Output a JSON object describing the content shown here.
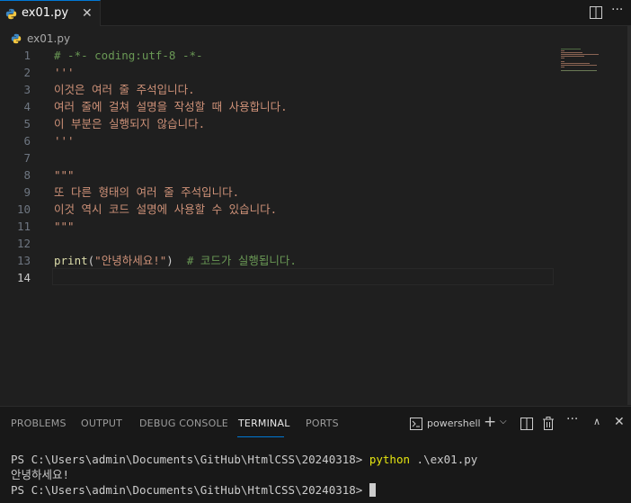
{
  "tab": {
    "title": "ex01.py",
    "close": "✕",
    "icon": "python-icon"
  },
  "tab_actions": {
    "split": "split-editor-icon",
    "more": "ellipsis-icon"
  },
  "breadcrumb": {
    "file": "ex01.py"
  },
  "editor": {
    "line_numbers": [
      "1",
      "2",
      "3",
      "4",
      "5",
      "6",
      "7",
      "8",
      "9",
      "10",
      "11",
      "12",
      "13",
      "14"
    ],
    "active_line": 14,
    "lines": [
      {
        "n": "1",
        "text": "# -*- coding:utf-8 -*-",
        "kind": "comment"
      },
      {
        "n": "2",
        "text": "'''",
        "kind": "string"
      },
      {
        "n": "3",
        "text": "이것은 여러 줄 주석입니다.",
        "kind": "string"
      },
      {
        "n": "4",
        "text": "여러 줄에 걸쳐 설명을 작성할 때 사용합니다.",
        "kind": "string"
      },
      {
        "n": "5",
        "text": "이 부분은 실행되지 않습니다.",
        "kind": "string"
      },
      {
        "n": "6",
        "text": "'''",
        "kind": "string"
      },
      {
        "n": "7",
        "text": "",
        "kind": "plain"
      },
      {
        "n": "8",
        "text": "\"\"\"",
        "kind": "string"
      },
      {
        "n": "9",
        "text": "또 다른 형태의 여러 줄 주석입니다.",
        "kind": "string"
      },
      {
        "n": "10",
        "text": "이것 역시 코드 설명에 사용할 수 있습니다.",
        "kind": "string"
      },
      {
        "n": "11",
        "text": "\"\"\"",
        "kind": "string"
      },
      {
        "n": "12",
        "text": "",
        "kind": "plain"
      }
    ],
    "line13": {
      "func": "print",
      "open": "(",
      "string": "\"안녕하세요!\"",
      "close": ")",
      "comment": "# 코드가 실행됩니다."
    }
  },
  "panel": {
    "tabs": [
      "PROBLEMS",
      "OUTPUT",
      "DEBUG CONSOLE",
      "TERMINAL",
      "PORTS"
    ],
    "active_tab": "TERMINAL",
    "shell": "powershell"
  },
  "terminal": {
    "prompt1": "PS C:\\Users\\admin\\Documents\\GitHub\\HtmlCSS\\20240318> ",
    "cmd": "python",
    "args": " .\\ex01.py",
    "output": "안녕하세요!",
    "prompt2": "PS C:\\Users\\admin\\Documents\\GitHub\\HtmlCSS\\20240318> "
  },
  "colors": {
    "accent": "#0078d4",
    "comment": "#6a9955",
    "string": "#ce9178",
    "function": "#dcdcaa",
    "command": "#e5e510"
  }
}
